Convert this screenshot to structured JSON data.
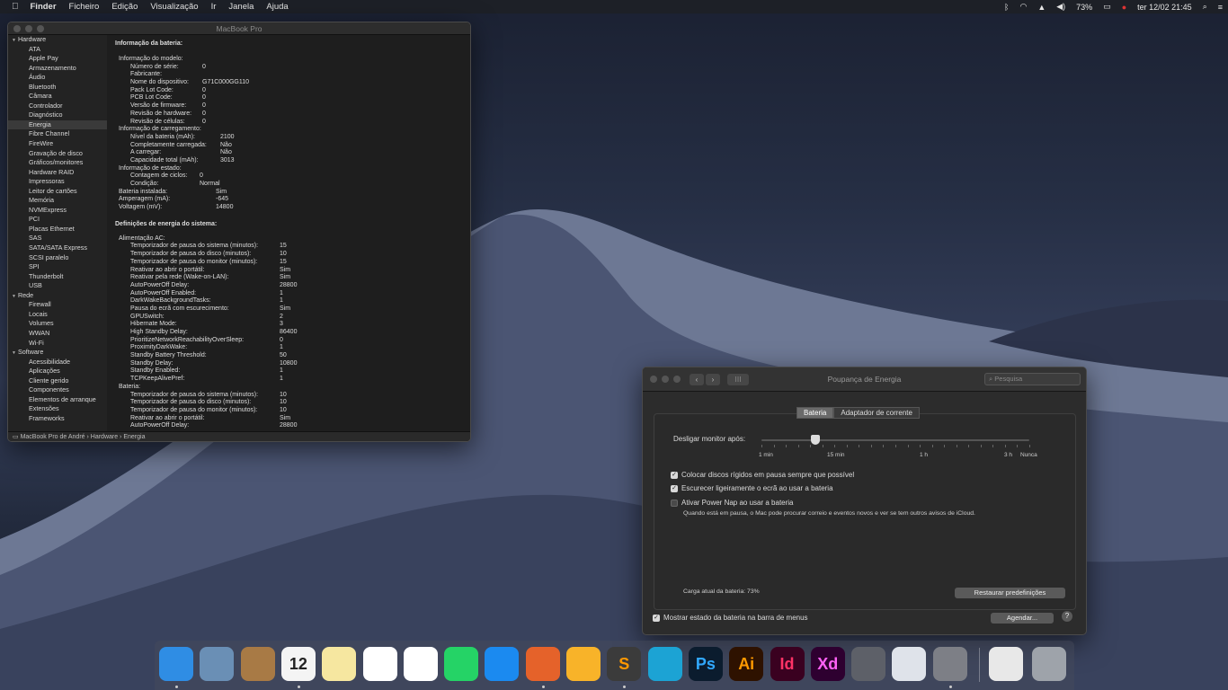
{
  "menubar": {
    "app": "Finder",
    "menus": [
      "Ficheiro",
      "Edição",
      "Visualização",
      "Ir",
      "Janela",
      "Ajuda"
    ],
    "battery": "73%",
    "datetime": "ter 12/02  21:45"
  },
  "info_window": {
    "title": "MacBook Pro",
    "sidebar": [
      {
        "type": "g",
        "label": "Hardware"
      },
      {
        "type": "i",
        "label": "ATA"
      },
      {
        "type": "i",
        "label": "Apple Pay"
      },
      {
        "type": "i",
        "label": "Armazenamento"
      },
      {
        "type": "i",
        "label": "Áudio"
      },
      {
        "type": "i",
        "label": "Bluetooth"
      },
      {
        "type": "i",
        "label": "Câmara"
      },
      {
        "type": "i",
        "label": "Controlador"
      },
      {
        "type": "i",
        "label": "Diagnóstico"
      },
      {
        "type": "i",
        "label": "Energia",
        "selected": true
      },
      {
        "type": "i",
        "label": "Fibre Channel"
      },
      {
        "type": "i",
        "label": "FireWire"
      },
      {
        "type": "i",
        "label": "Gravação de disco"
      },
      {
        "type": "i",
        "label": "Gráficos/monitores"
      },
      {
        "type": "i",
        "label": "Hardware RAID"
      },
      {
        "type": "i",
        "label": "Impressoras"
      },
      {
        "type": "i",
        "label": "Leitor de cartões"
      },
      {
        "type": "i",
        "label": "Memória"
      },
      {
        "type": "i",
        "label": "NVMExpress"
      },
      {
        "type": "i",
        "label": "PCI"
      },
      {
        "type": "i",
        "label": "Placas Ethernet"
      },
      {
        "type": "i",
        "label": "SAS"
      },
      {
        "type": "i",
        "label": "SATA/SATA Express"
      },
      {
        "type": "i",
        "label": "SCSI paralelo"
      },
      {
        "type": "i",
        "label": "SPI"
      },
      {
        "type": "i",
        "label": "Thunderbolt"
      },
      {
        "type": "i",
        "label": "USB"
      },
      {
        "type": "g",
        "label": "Rede"
      },
      {
        "type": "i",
        "label": "Firewall"
      },
      {
        "type": "i",
        "label": "Locais"
      },
      {
        "type": "i",
        "label": "Volumes"
      },
      {
        "type": "i",
        "label": "WWAN"
      },
      {
        "type": "i",
        "label": "Wi-Fi"
      },
      {
        "type": "g",
        "label": "Software"
      },
      {
        "type": "i",
        "label": "Acessibilidade"
      },
      {
        "type": "i",
        "label": "Aplicações"
      },
      {
        "type": "i",
        "label": "Cliente gerido"
      },
      {
        "type": "i",
        "label": "Componentes"
      },
      {
        "type": "i",
        "label": "Elementos de arranque"
      },
      {
        "type": "i",
        "label": "Extensões"
      },
      {
        "type": "i",
        "label": "Frameworks"
      }
    ],
    "heading1": "Informação da bateria:",
    "battery_rows": [
      {
        "i": 0,
        "k": "Informação do modelo:",
        "v": ""
      },
      {
        "i": 1,
        "k": "Número de série:",
        "v": "0"
      },
      {
        "i": 1,
        "k": "Fabricante:",
        "v": ""
      },
      {
        "i": 1,
        "k": "Nome do dispositivo:",
        "v": "G71C000GG110"
      },
      {
        "i": 1,
        "k": "Pack Lot Code:",
        "v": "0"
      },
      {
        "i": 1,
        "k": "PCB Lot Code:",
        "v": "0"
      },
      {
        "i": 1,
        "k": "Versão de firmware:",
        "v": "0"
      },
      {
        "i": 1,
        "k": "Revisão de hardware:",
        "v": "0"
      },
      {
        "i": 1,
        "k": "Revisão de células:",
        "v": "0"
      },
      {
        "i": 0,
        "k": "Informação de carregamento:",
        "v": ""
      },
      {
        "i": 1,
        "k": "Nível da bateria (mAh):",
        "v": "2100"
      },
      {
        "i": 1,
        "k": "Completamente carregada:",
        "v": "Não"
      },
      {
        "i": 1,
        "k": "A carregar:",
        "v": "Não"
      },
      {
        "i": 1,
        "k": "Capacidade total (mAh):",
        "v": "3013"
      },
      {
        "i": 0,
        "k": "Informação de estado:",
        "v": ""
      },
      {
        "i": 1,
        "k": "Contagem de ciclos:",
        "v": "0"
      },
      {
        "i": 1,
        "k": "Condição:",
        "v": "Normal"
      },
      {
        "i": 0,
        "k": "Bateria instalada:",
        "v": "Sim"
      },
      {
        "i": 0,
        "k": "Amperagem (mA):",
        "v": "-645"
      },
      {
        "i": 0,
        "k": "Voltagem (mV):",
        "v": "14800"
      }
    ],
    "heading2": "Definições de energia do sistema:",
    "power_rows": [
      {
        "i": 0,
        "k": "Alimentação AC:",
        "v": ""
      },
      {
        "i": 1,
        "k": "Temporizador de pausa do sistema (minutos):",
        "v": "15"
      },
      {
        "i": 1,
        "k": "Temporizador de pausa do disco (minutos):",
        "v": "10"
      },
      {
        "i": 1,
        "k": "Temporizador de pausa do monitor (minutos):",
        "v": "15"
      },
      {
        "i": 1,
        "k": "Reativar ao abrir o portátil:",
        "v": "Sim"
      },
      {
        "i": 1,
        "k": "Reativar pela rede (Wake-on-LAN):",
        "v": "Sim"
      },
      {
        "i": 1,
        "k": "AutoPowerOff Delay:",
        "v": "28800"
      },
      {
        "i": 1,
        "k": "AutoPowerOff Enabled:",
        "v": "1"
      },
      {
        "i": 1,
        "k": "DarkWakeBackgroundTasks:",
        "v": "1"
      },
      {
        "i": 1,
        "k": "Pausa do ecrã com escurecimento:",
        "v": "Sim"
      },
      {
        "i": 1,
        "k": "GPUSwitch:",
        "v": "2"
      },
      {
        "i": 1,
        "k": "Hibernate Mode:",
        "v": "3"
      },
      {
        "i": 1,
        "k": "High Standby Delay:",
        "v": "86400"
      },
      {
        "i": 1,
        "k": "PrioritizeNetworkReachabilityOverSleep:",
        "v": "0"
      },
      {
        "i": 1,
        "k": "ProximityDarkWake:",
        "v": "1"
      },
      {
        "i": 1,
        "k": "Standby Battery Threshold:",
        "v": "50"
      },
      {
        "i": 1,
        "k": "Standby Delay:",
        "v": "10800"
      },
      {
        "i": 1,
        "k": "Standby Enabled:",
        "v": "1"
      },
      {
        "i": 1,
        "k": "TCPKeepAlivePref:",
        "v": "1"
      },
      {
        "i": 0,
        "k": "Bateria:",
        "v": ""
      },
      {
        "i": 1,
        "k": "Temporizador de pausa do sistema (minutos):",
        "v": "10"
      },
      {
        "i": 1,
        "k": "Temporizador de pausa do disco (minutos):",
        "v": "10"
      },
      {
        "i": 1,
        "k": "Temporizador de pausa do monitor (minutos):",
        "v": "10"
      },
      {
        "i": 1,
        "k": "Reativar ao abrir o portátil:",
        "v": "Sim"
      },
      {
        "i": 1,
        "k": "AutoPowerOff Delay:",
        "v": "28800"
      }
    ],
    "pathbar": "MacBook Pro de André  ›  Hardware  ›  Energia"
  },
  "energy": {
    "title": "Poupança de Energia",
    "search_placeholder": "Pesquisa",
    "tabs": [
      "Bateria",
      "Adaptador de corrente"
    ],
    "slider_label": "Desligar monitor após:",
    "slider_value_fraction": 0.2,
    "tick_labels": [
      "1 min",
      "15 min",
      "1 h",
      "3 h",
      "Nunca"
    ],
    "checks": [
      {
        "label": "Colocar discos rígidos em pausa sempre que possível",
        "checked": true
      },
      {
        "label": "Escurecer ligeiramente o ecrã ao usar a bateria",
        "checked": true
      },
      {
        "label": "Ativar Power Nap ao usar a bateria",
        "checked": false
      }
    ],
    "powernap_note": "Quando está em pausa, o Mac pode procurar correio e eventos novos e ver se tem outros avisos de iCloud.",
    "charge": "Carga atual da bateria: 73%",
    "restore_btn": "Restaurar predefinições",
    "show_status": "Mostrar estado da bateria na barra de menus",
    "schedule_btn": "Agendar...",
    "help": "?"
  },
  "dock": [
    {
      "name": "finder-icon",
      "bg": "#2f8de4",
      "txt": ""
    },
    {
      "name": "preview-icon",
      "bg": "#6a8fb5",
      "txt": ""
    },
    {
      "name": "contacts-icon",
      "bg": "#a87a45",
      "txt": ""
    },
    {
      "name": "calendar-icon",
      "bg": "#f4f4f4",
      "txt": "12"
    },
    {
      "name": "notes-icon",
      "bg": "#f6e7a0",
      "txt": ""
    },
    {
      "name": "photos-icon",
      "bg": "#ffffff",
      "txt": ""
    },
    {
      "name": "itunes-icon",
      "bg": "#ffffff",
      "txt": ""
    },
    {
      "name": "whatsapp-icon",
      "bg": "#25d366",
      "txt": ""
    },
    {
      "name": "appstore-icon",
      "bg": "#1b8af0",
      "txt": ""
    },
    {
      "name": "firefox-icon",
      "bg": "#e5622a",
      "txt": ""
    },
    {
      "name": "sketch-icon",
      "bg": "#f8b329",
      "txt": ""
    },
    {
      "name": "sublime-icon",
      "bg": "#3b3b3b",
      "txt": "S"
    },
    {
      "name": "sourcetree-icon",
      "bg": "#1ca3d4",
      "txt": ""
    },
    {
      "name": "photoshop-icon",
      "bg": "#0b1c2e",
      "txt": "Ps"
    },
    {
      "name": "illustrator-icon",
      "bg": "#2e1200",
      "txt": "Ai"
    },
    {
      "name": "indesign-icon",
      "bg": "#3a0120",
      "txt": "Id"
    },
    {
      "name": "xd-icon",
      "bg": "#2e0030",
      "txt": "Xd"
    },
    {
      "name": "system-info-icon",
      "bg": "#5d6068",
      "txt": ""
    },
    {
      "name": "xcode-icon",
      "bg": "#dfe3ea",
      "txt": ""
    },
    {
      "name": "system-preferences-icon",
      "bg": "#7d7f86",
      "txt": ""
    },
    {
      "name": "downloads-stack-icon",
      "bg": "#e8e8e8",
      "txt": ""
    },
    {
      "name": "trash-icon",
      "bg": "#9ea3aa",
      "txt": ""
    }
  ]
}
